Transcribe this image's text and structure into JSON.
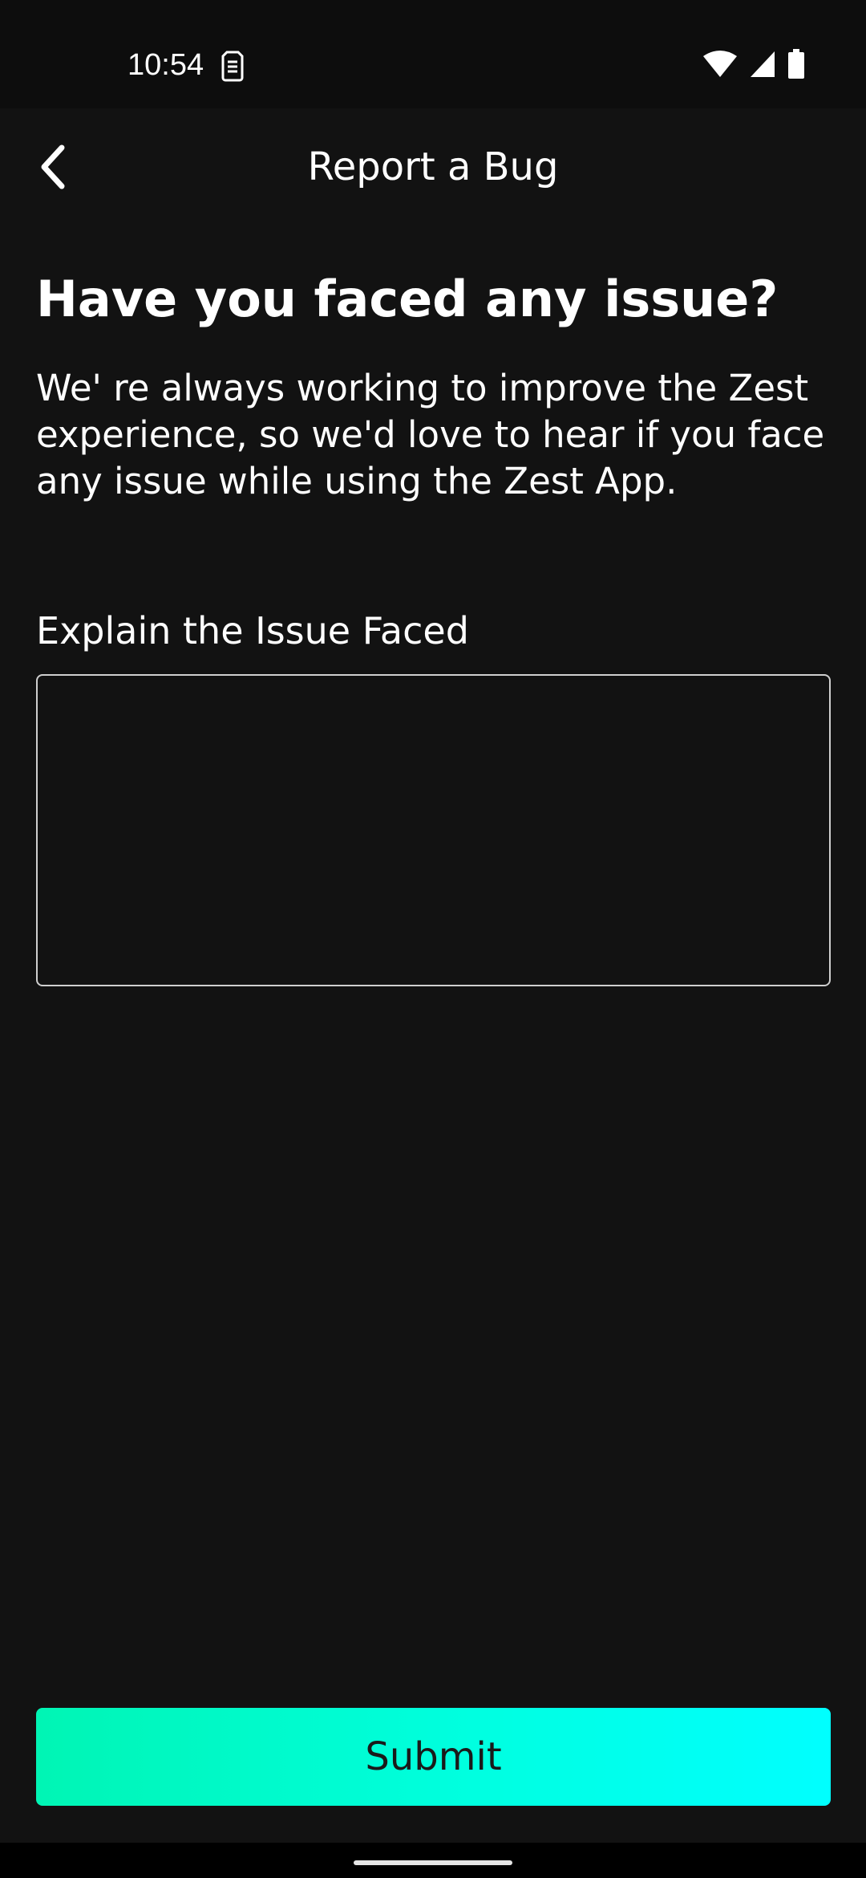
{
  "status_bar": {
    "time": "10:54",
    "notification_icon": "sim-card-icon",
    "icons": [
      "wifi-icon",
      "cell-signal-icon",
      "battery-icon"
    ]
  },
  "toolbar": {
    "title": "Report a Bug",
    "back_icon": "chevron-left-icon"
  },
  "main": {
    "heading": "Have you faced any issue?",
    "description": "We' re always working to improve the Zest experience, so we'd love to hear if you face any issue while using the Zest App.",
    "field_label": "Explain the Issue Faced",
    "field_value": "",
    "field_placeholder": ""
  },
  "submit": {
    "label": "Submit"
  },
  "colors": {
    "background": "#121212",
    "status_bar": "#0d0d0d",
    "accent_gradient_start": "#00f5b4",
    "accent_gradient_end": "#00ffff",
    "text": "#ffffff"
  }
}
